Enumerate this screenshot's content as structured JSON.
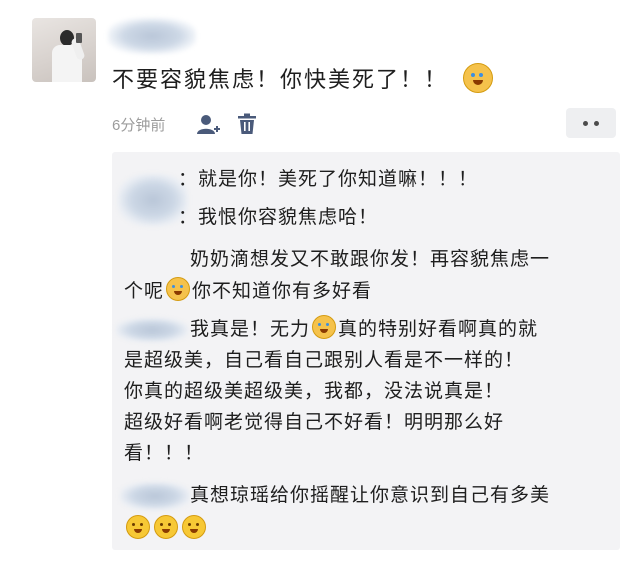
{
  "post": {
    "text": "不要容貌焦虑！你快美死了！！",
    "emoji": "tear-face-emoji"
  },
  "meta": {
    "timestamp": "6分钟前",
    "like_icon": "person-icon",
    "delete_icon": "trash-icon",
    "more_icon": "more-dots-icon"
  },
  "comments": [
    {
      "lines": [
        "：就是你！美死了你知道嘛！！！"
      ]
    },
    {
      "lines": [
        "：我恨你容貌焦虑哈！"
      ]
    },
    {
      "lines_a": "奶奶滴想发又不敢跟你发！再容貌焦虑一",
      "line_b_1": "个呢",
      "line_b_2": "你不知道你有多好看"
    },
    {
      "line1_a": "我真是！无力",
      "line1_b": "真的特别好看啊真的就",
      "line2": "是超级美，自己看自己跟别人看是不一样的！",
      "line3": "你真的超级美超级美，我都，没法说真是！",
      "line4": "超级好看啊老觉得自己不好看！明明那么好",
      "line5": "看！！！"
    },
    {
      "line1": "真想琼瑶给你摇醒让你意识到自己有多美",
      "emojis": [
        "laughing-cry-emoji",
        "laughing-cry-emoji",
        "laughing-cry-emoji"
      ]
    }
  ],
  "colors": {
    "panel_bg": "#f3f3f5",
    "timestamp": "#9c9c9c",
    "icon_blue": "#4a5a7a"
  }
}
